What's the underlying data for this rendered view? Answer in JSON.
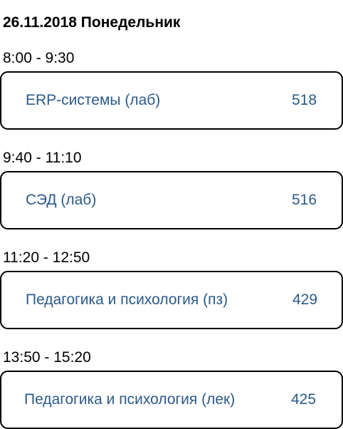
{
  "header": {
    "date": "26.11.2018",
    "weekday": "Понедельник",
    "full": "26.11.2018 Понедельник"
  },
  "colors": {
    "title_text": "#2b5a8a",
    "card_border": "#000000",
    "background": "#ffffff"
  },
  "lessons": [
    {
      "time": "8:00 - 9:30",
      "title": "ERP-системы (лаб)",
      "room": "518"
    },
    {
      "time": "9:40 - 11:10",
      "title": "СЭД (лаб)",
      "room": "516"
    },
    {
      "time": "11:20 - 12:50",
      "title": "Педагогика и психология (пз)",
      "room": "429"
    },
    {
      "time": "13:50 - 15:20",
      "title": "Педагогика и психология (лек)",
      "room": "425"
    }
  ]
}
